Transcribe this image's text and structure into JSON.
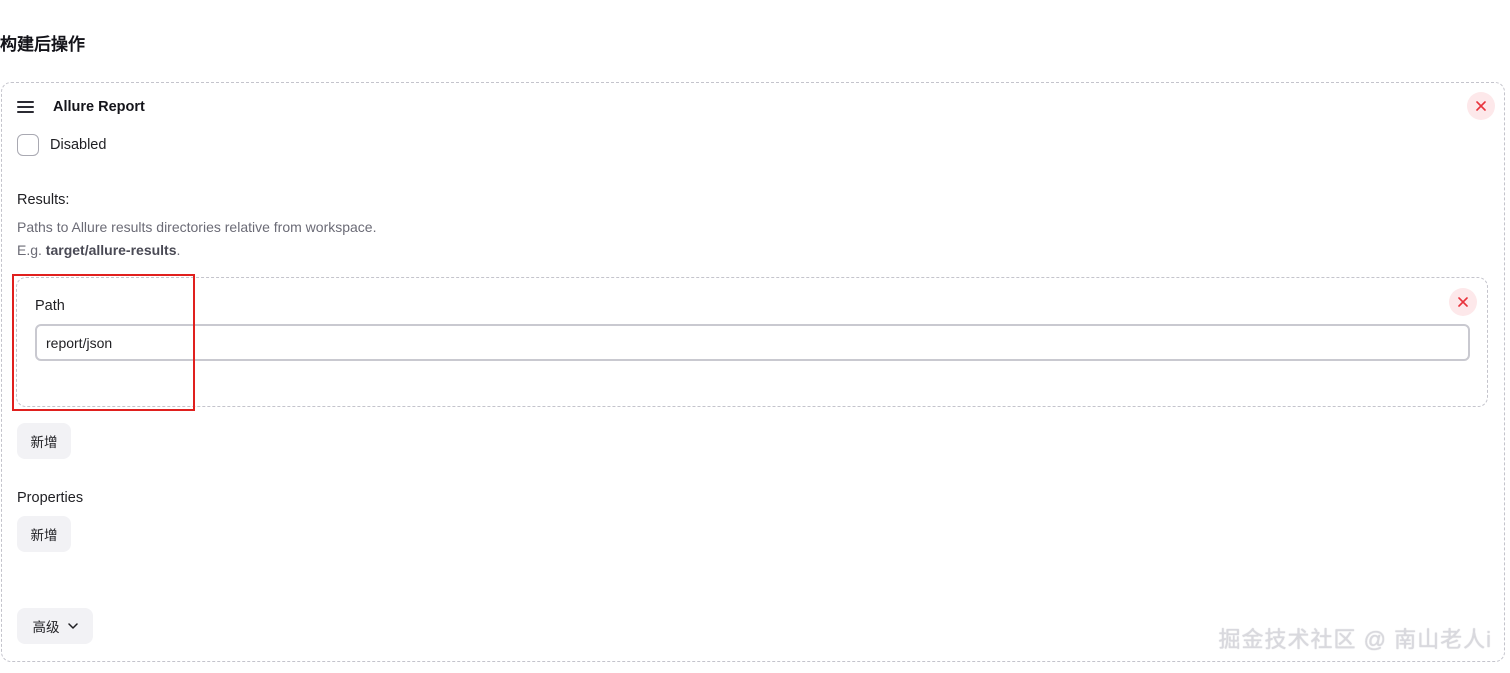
{
  "section": {
    "title": "构建后操作"
  },
  "allure_card": {
    "title": "Allure Report",
    "disabled_label": "Disabled",
    "results_label": "Results:",
    "help_line1": "Paths to Allure results directories relative from workspace.",
    "help_prefix": "E.g. ",
    "help_example": "target/allure-results",
    "help_suffix": ".",
    "path_card": {
      "label": "Path",
      "value": "report/json"
    },
    "add_results_button": "新增",
    "properties_label": "Properties",
    "add_properties_button": "新增",
    "advanced_button": "高级"
  },
  "watermark": "掘金技术社区 @ 南山老人i",
  "icons": {
    "drag": "drag-handle-icon",
    "close": "close-icon",
    "chevron": "chevron-down-icon"
  },
  "colors": {
    "close_bg": "#fde8ea",
    "close_fg": "#e8333c",
    "highlight": "#e0201e"
  }
}
